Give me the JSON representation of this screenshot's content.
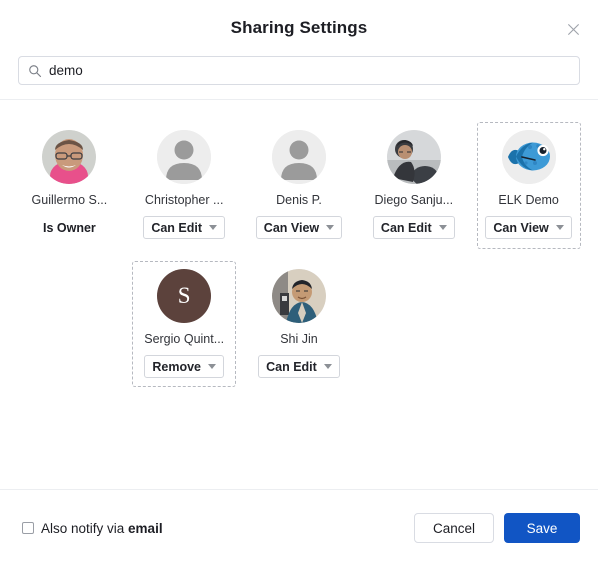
{
  "dialog": {
    "title": "Sharing Settings",
    "close_icon": "close-icon"
  },
  "search": {
    "icon": "search-icon",
    "value": "demo",
    "placeholder": "Search"
  },
  "people": [
    {
      "name": "Guillermo S...",
      "avatar_type": "photo-guillermo",
      "role": "Is Owner",
      "role_is_dropdown": false,
      "selected": false
    },
    {
      "name": "Christopher ...",
      "avatar_type": "placeholder",
      "role": "Can Edit",
      "role_is_dropdown": true,
      "selected": false
    },
    {
      "name": "Denis P.",
      "avatar_type": "placeholder",
      "role": "Can View",
      "role_is_dropdown": true,
      "selected": false
    },
    {
      "name": "Diego Sanju...",
      "avatar_type": "photo-diego",
      "role": "Can Edit",
      "role_is_dropdown": true,
      "selected": false
    },
    {
      "name": "ELK Demo",
      "avatar_type": "elk-fish-logo",
      "role": "Can View",
      "role_is_dropdown": true,
      "selected": true
    },
    {
      "name": "Sergio Quint...",
      "avatar_type": "initial",
      "initial": "S",
      "initial_bg": "#5c423c",
      "role": "Remove",
      "role_is_dropdown": true,
      "selected": true
    },
    {
      "name": "Shi Jin",
      "avatar_type": "photo-shijin",
      "role": "Can Edit",
      "role_is_dropdown": true,
      "selected": false
    }
  ],
  "footer": {
    "notify_prefix": "Also notify via ",
    "notify_bold": "email",
    "checkbox_checked": false,
    "cancel_label": "Cancel",
    "save_label": "Save"
  },
  "colors": {
    "accent": "#1155c4",
    "border": "#d9dce3",
    "selection_border": "#b6b9c0",
    "text": "#1d1e24"
  }
}
